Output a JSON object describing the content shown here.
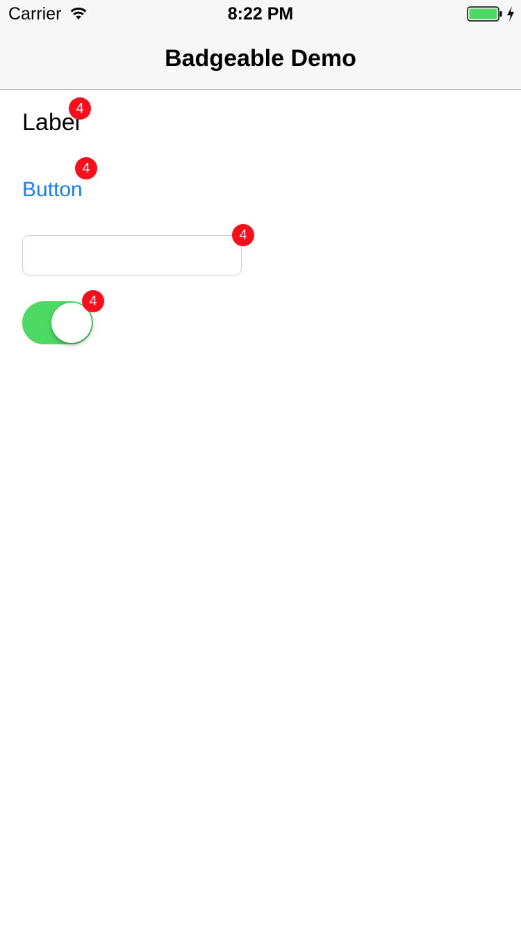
{
  "status_bar": {
    "carrier": "Carrier",
    "time": "8:22 PM",
    "wifi_icon": "wifi-icon",
    "battery_icon": "battery-icon",
    "charging_icon": "bolt-icon",
    "battery_color": "#4cd964"
  },
  "nav": {
    "title": "Badgeable Demo"
  },
  "content": {
    "label": {
      "text": "Label",
      "badge": "4"
    },
    "button": {
      "text": "Button",
      "badge": "4"
    },
    "text_field": {
      "value": "",
      "placeholder": "",
      "badge": "4"
    },
    "toggle": {
      "state": "on",
      "badge": "4"
    }
  },
  "colors": {
    "badge": "#fc0d1b",
    "tint": "#157efb",
    "switch_on": "#4cd964"
  }
}
